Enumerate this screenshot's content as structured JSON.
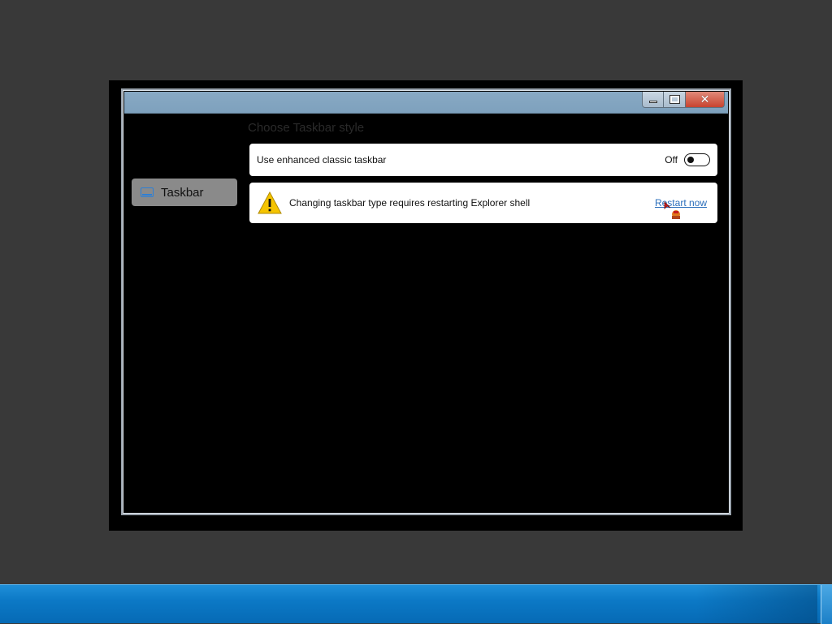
{
  "window": {
    "caption_buttons": {
      "minimize_icon": "minimize-icon",
      "maximize_icon": "maximize-icon",
      "close_glyph": "✕"
    }
  },
  "sidebar": {
    "items": [
      {
        "label": "Taskbar",
        "icon": "taskbar-icon",
        "selected": true
      }
    ]
  },
  "main": {
    "section_title": "Choose Taskbar style",
    "toggle_setting": {
      "label": "Use enhanced classic taskbar",
      "state_text": "Off",
      "value": false
    },
    "warning": {
      "icon": "warning-icon",
      "message": "Changing taskbar type requires restarting Explorer shell",
      "action_link": "Restart now"
    }
  },
  "colors": {
    "titlebar": "#7ea1bd",
    "taskbar": "#0c79c6",
    "link": "#2a6ebb",
    "warning": "#f5c400"
  }
}
